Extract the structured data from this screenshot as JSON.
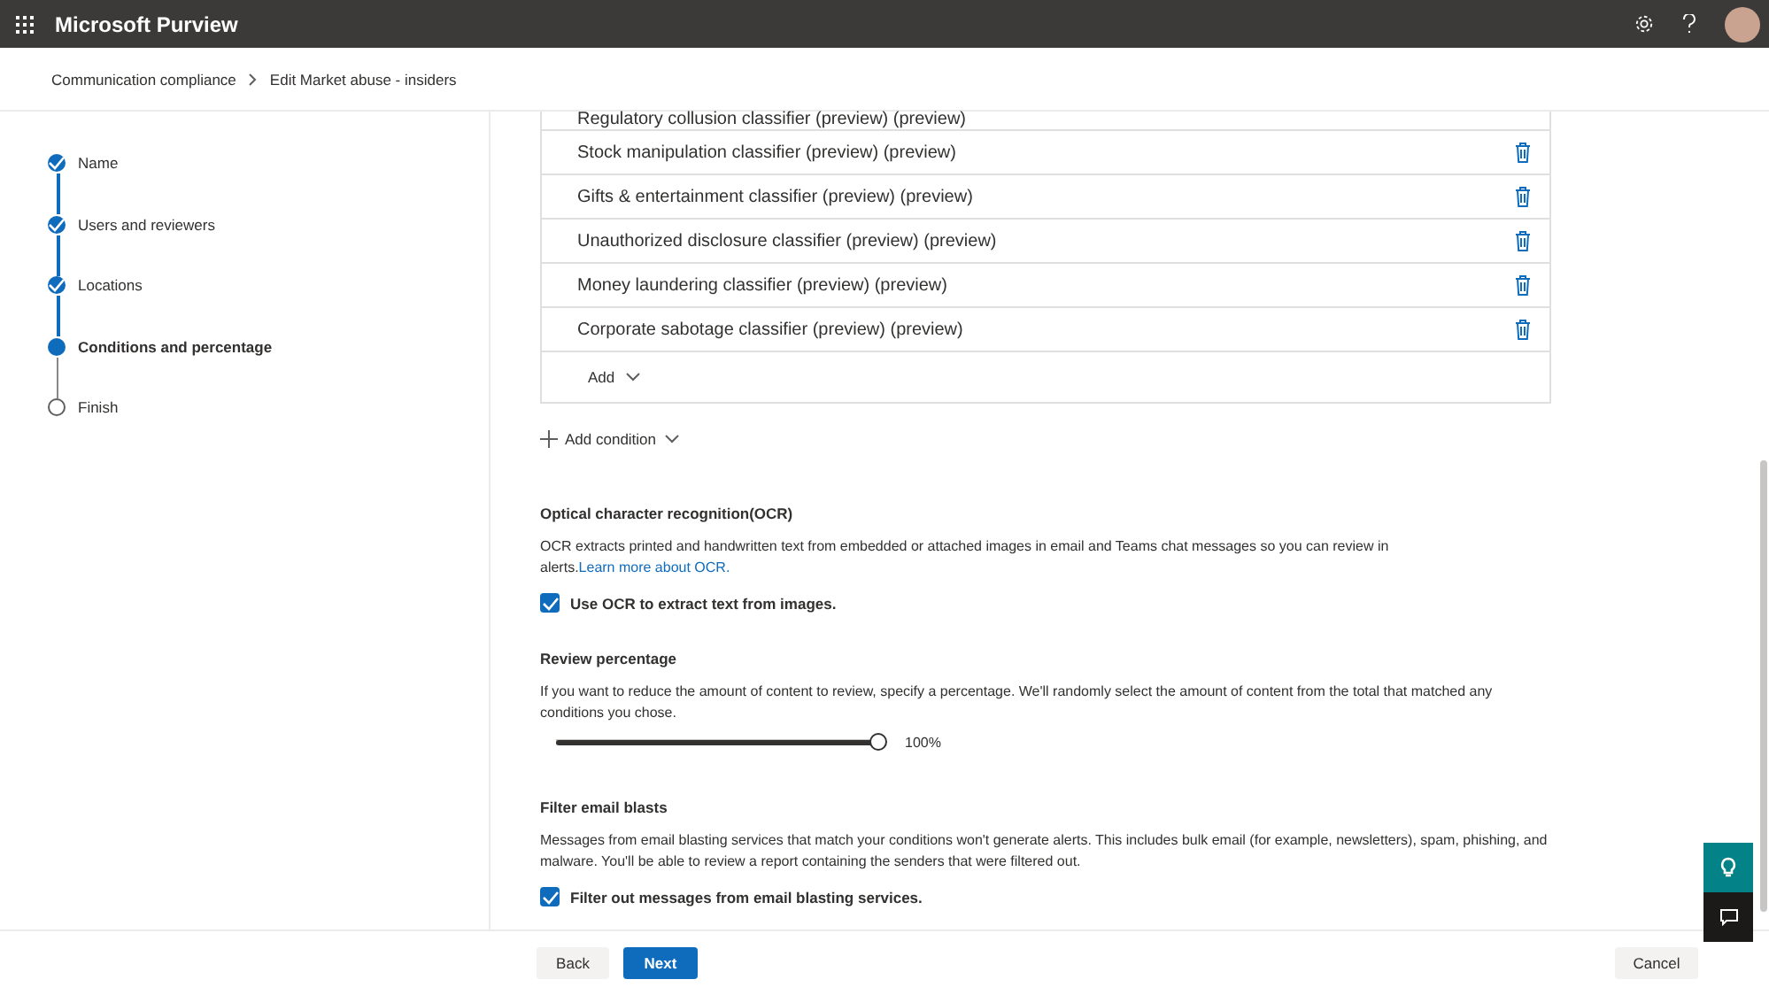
{
  "header": {
    "title": "Microsoft Purview"
  },
  "breadcrumb": [
    "Communication compliance",
    "Edit Market abuse - insiders"
  ],
  "steps": [
    {
      "label": "Name",
      "completed": true,
      "selected": false
    },
    {
      "label": "Users and reviewers",
      "completed": true,
      "selected": false
    },
    {
      "label": "Locations",
      "completed": true,
      "selected": false
    },
    {
      "label": "Conditions and percentage",
      "completed": false,
      "selected": true
    },
    {
      "label": "Finish",
      "completed": false,
      "selected": false
    }
  ],
  "classifiers": [
    "Regulatory collusion classifier (preview) (preview)",
    "Stock manipulation classifier (preview) (preview)",
    "Gifts & entertainment classifier (preview) (preview)",
    "Unauthorized disclosure classifier (preview) (preview)",
    "Money laundering classifier (preview) (preview)",
    "Corporate sabotage classifier (preview) (preview)"
  ],
  "add_button": "Add",
  "add_condition": "Add condition",
  "ocr": {
    "heading": "Optical character recognition(OCR)",
    "text": "OCR extracts printed and handwritten text from embedded or attached images in email and Teams chat messages so you can review in alerts.",
    "link": "Learn more about OCR.",
    "checkbox": {
      "label": "Use OCR to extract text from images.",
      "checked": true
    }
  },
  "review": {
    "heading": "Review percentage",
    "text": "If you want to reduce the amount of content to review, specify a percentage. We'll randomly select the amount of content from the total that matched any conditions you chose.",
    "level": 1,
    "reading": "100%"
  },
  "filter": {
    "heading": "Filter email blasts",
    "text": "Messages from email blasting services that match your conditions won't generate alerts. This includes bulk email (for example, newsletters), spam, phishing, and malware. You'll be able to review a report containing the senders that were filtered out.",
    "checkbox": {
      "label": "Filter out messages from email blasting services.",
      "checked": true
    }
  },
  "footer": {
    "back": "Back",
    "next": "Next",
    "cancel": "Cancel"
  }
}
